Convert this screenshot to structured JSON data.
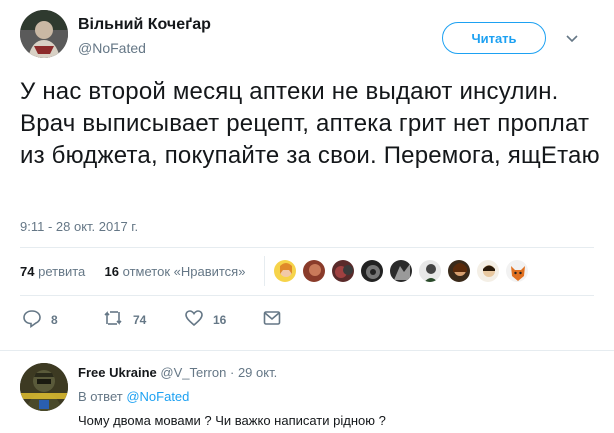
{
  "tweet": {
    "author_name": "Вільний Кочеґар",
    "author_handle": "@NoFated",
    "follow_label": "Читать",
    "text": "У нас второй месяц аптеки не выдают инсулин. Врач выписывает рецепт, аптека грит нет проплат из бюджета, покупайте за свои. Перемога, ящЕтаю",
    "timestamp": "9:11 - 28 окт. 2017 г.",
    "stats": {
      "retweets_count": "74",
      "retweets_label": "ретвита",
      "likes_count": "16",
      "likes_label": "отметок «Нравится»"
    },
    "actions": {
      "reply_count": "8",
      "retweet_count": "74",
      "like_count": "16"
    }
  },
  "reply": {
    "author_name": "Free Ukraine",
    "author_handle": "@V_Terron",
    "separator": "·",
    "date": "29 окт.",
    "in_reply_prefix": "В ответ",
    "in_reply_mention": "@NoFated",
    "text": "Чому двома мовами ? Чи важко написати рідною ?"
  },
  "colors": {
    "accent": "#1da1f2",
    "muted": "#657786",
    "text": "#14171a",
    "divider": "#e6ecf0"
  },
  "icons": [
    "caret-down-icon",
    "reply-icon",
    "retweet-icon",
    "heart-icon",
    "direct-message-icon"
  ]
}
